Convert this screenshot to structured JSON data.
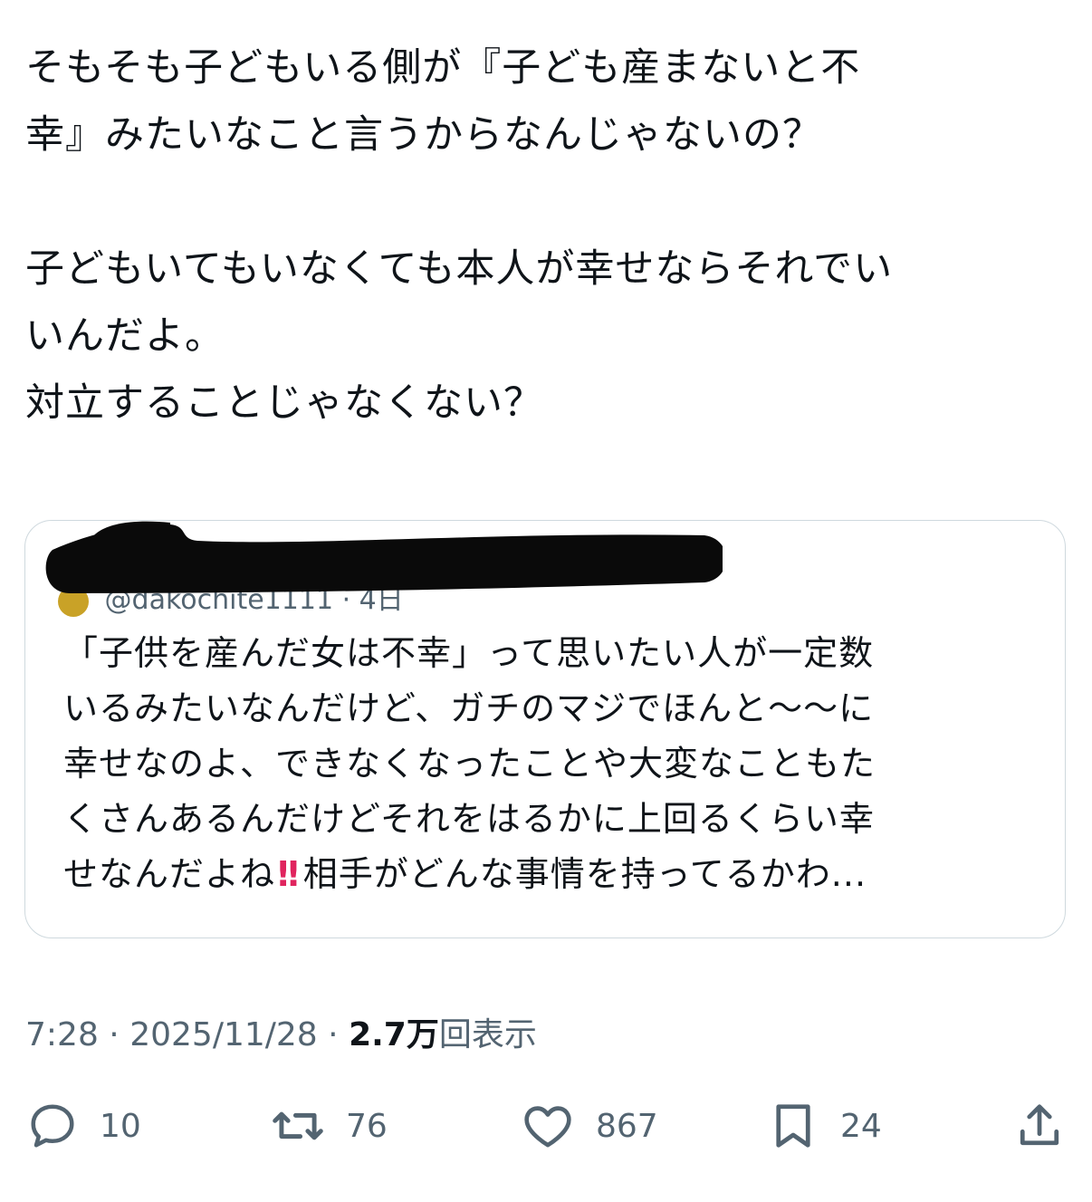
{
  "tweet": {
    "paragraph1": [
      "そもそも子どもいる側が『子ども産まないと不",
      "幸』みたいなこと言うからなんじゃないの？"
    ],
    "paragraph2": [
      "子どもいてもいなくても本人が幸せならそれでい",
      "いんだよ。",
      "対立することじゃなくない？"
    ]
  },
  "quote": {
    "header_visible_fragment": "@dakochite1111 · 4日",
    "lines": [
      "「子供を産んだ女は不幸」って思いたい人が一定数",
      "いるみたいなんだけど、ガチのマジでほんと〜〜に",
      "幸せなのよ、できなくなったことや大変なこともた",
      "くさんあるんだけどそれをはるかに上回るくらい幸",
      "せなんだよね"
    ],
    "emoji": "!!",
    "last_line_tail": "相手がどんな事情を持ってるかわ..."
  },
  "meta": {
    "time": "7:28",
    "separator": "·",
    "date": "2025/11/28",
    "views_count": "2.7万",
    "views_label": "回表示"
  },
  "actions": {
    "reply_count": "10",
    "retweet_count": "76",
    "like_count": "867",
    "bookmark_count": "24"
  },
  "colors": {
    "text": "#0f1419",
    "secondary": "#536471",
    "border": "#cfd9de",
    "emoji_red": "#e0245e"
  }
}
